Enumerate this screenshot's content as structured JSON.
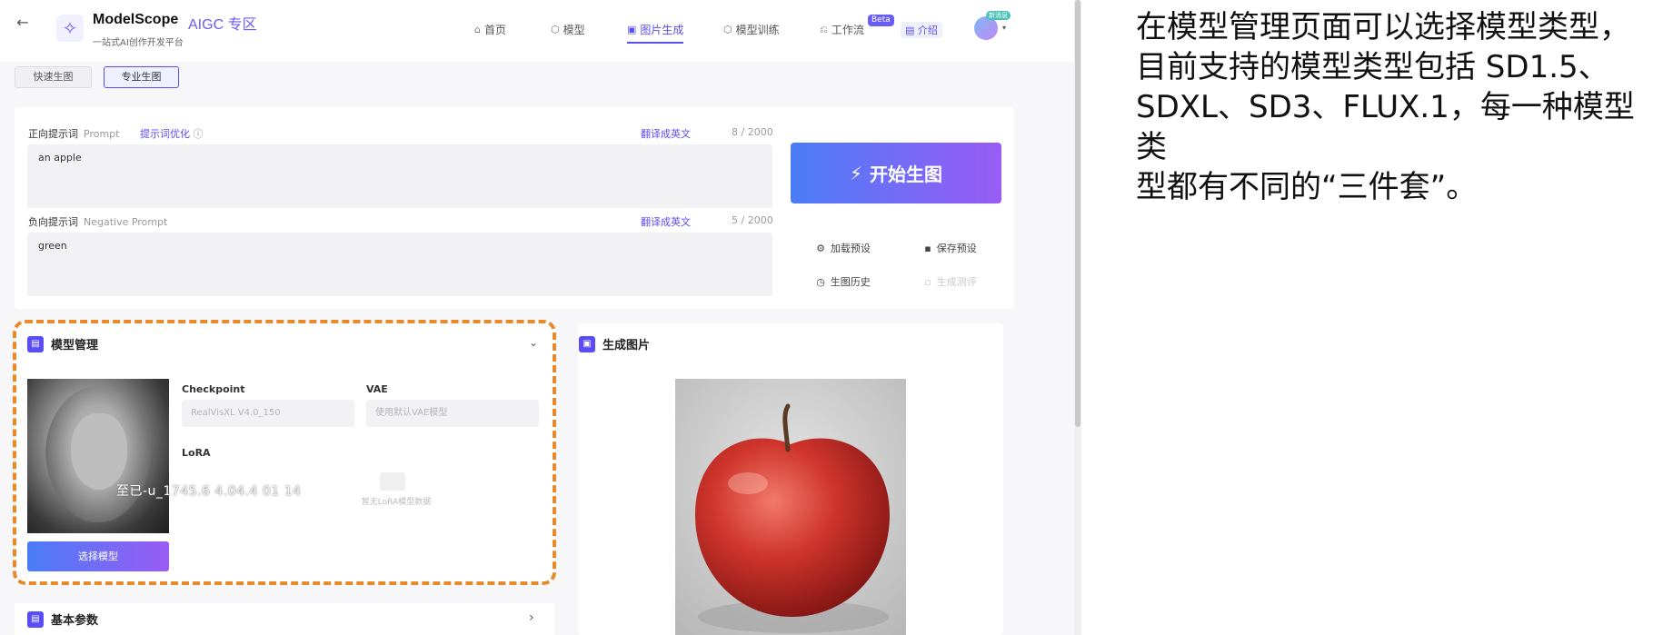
{
  "header": {
    "back_icon": "back-arrow-icon",
    "brand": "ModelScope",
    "zone": "AIGC 专区",
    "tagline": "一站式AI创作开发平台",
    "nav": [
      {
        "label": "首页",
        "icon": "home-icon"
      },
      {
        "label": "模型",
        "icon": "cube-icon"
      },
      {
        "label": "图片生成",
        "icon": "image-icon",
        "active": true
      },
      {
        "label": "模型训练",
        "icon": "cube-icon"
      },
      {
        "label": "工作流",
        "icon": "workflow-icon"
      }
    ],
    "beta_badge": "Beta",
    "intro_label": "介绍",
    "avatar_badge": "新消息"
  },
  "mode_tabs": [
    {
      "label": "快速生图",
      "active": false
    },
    {
      "label": "专业生图",
      "active": true
    }
  ],
  "prompt": {
    "positive_label": "正向提示词",
    "positive_label_en": "Prompt",
    "optimize_link": "提示词优化",
    "translate_link": "翻译成英文",
    "positive_count": "8 / 2000",
    "positive_value": "an apple",
    "negative_label": "负向提示词",
    "negative_label_en": "Negative Prompt",
    "negative_count": "5 / 2000",
    "negative_value": "green"
  },
  "actions": {
    "start_label": "开始生图",
    "load_preset": "加载预设",
    "save_preset": "保存预设",
    "history": "生图历史",
    "disabled_action": "生成测评"
  },
  "model_panel": {
    "title": "模型管理",
    "checkpoint_label": "Checkpoint",
    "checkpoint_value": "RealVisXL V4.0_150",
    "vae_label": "VAE",
    "vae_placeholder": "使用默认VAE模型",
    "lora_label": "LoRA",
    "lora_empty": "暂无LoRA模型数据",
    "select_button": "选择模型",
    "watermark_main": "至已-u_",
    "watermark_rest": "1745.6 4.04.4 01 14"
  },
  "output_panel": {
    "title": "生成图片"
  },
  "basic_params": {
    "title": "基本参数"
  },
  "caption": {
    "lines": [
      "在模型管理页面可以选择模型类型，",
      "目前支持的模型类型包括 SD1.5、",
      "SDXL、SD3、FLUX.1，每一种模型类",
      "型都有不同的“三件套”。"
    ]
  },
  "colors": {
    "accent": "#5b4df5",
    "highlight_border": "#e88a2c"
  }
}
